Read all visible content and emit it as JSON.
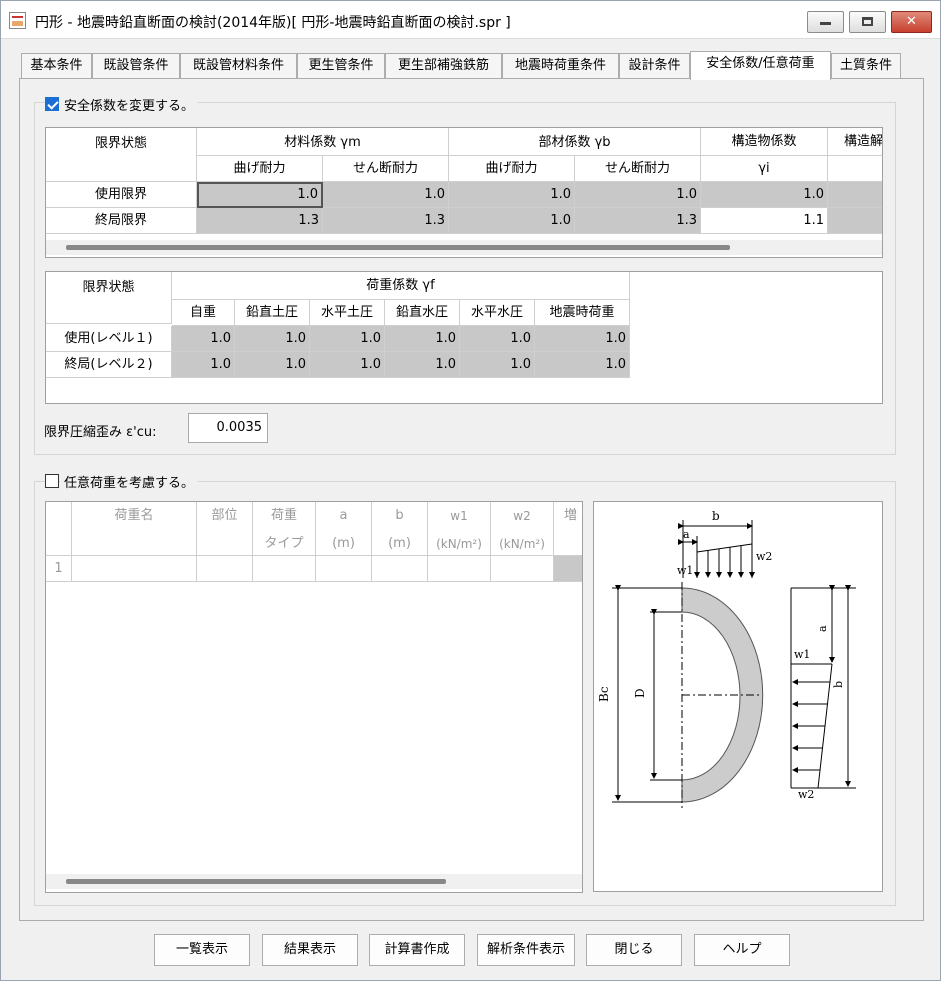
{
  "window": {
    "title": "円形 - 地震時鉛直断面の検討(2014年版)[ 円形-地震時鉛直断面の検討.spr ]"
  },
  "tabs": [
    "基本条件",
    "既設管条件",
    "既設管材料条件",
    "更生管条件",
    "更生部補強鉄筋",
    "地震時荷重条件",
    "設計条件",
    "安全係数/任意荷重",
    "土質条件"
  ],
  "safety": {
    "checkbox_label": "安全係数を変更する。",
    "checked": true,
    "table1": {
      "h_state": "限界状態",
      "h_material": "材料係数 γm",
      "h_member": "部材係数 γb",
      "h_structure": "構造物係数",
      "h_structure_sub": "γi",
      "h_cut": "構造解",
      "h_bend": "曲げ耐力",
      "h_shear": "せん断耐力",
      "rows": [
        {
          "label": "使用限界",
          "values": [
            "1.0",
            "1.0",
            "1.0",
            "1.0",
            "1.0"
          ]
        },
        {
          "label": "終局限界",
          "values": [
            "1.3",
            "1.3",
            "1.0",
            "1.3",
            "1.1"
          ]
        }
      ]
    },
    "table2": {
      "h_state": "限界状態",
      "h_load": "荷重係数 γf",
      "cols": [
        "自重",
        "鉛直土圧",
        "水平土圧",
        "鉛直水圧",
        "水平水圧",
        "地震時荷重"
      ],
      "rows": [
        {
          "label": "使用(レベル１)",
          "values": [
            "1.0",
            "1.0",
            "1.0",
            "1.0",
            "1.0",
            "1.0"
          ]
        },
        {
          "label": "終局(レベル２)",
          "values": [
            "1.0",
            "1.0",
            "1.0",
            "1.0",
            "1.0",
            "1.0"
          ]
        }
      ]
    },
    "strain_label": "限界圧縮歪み ε'cu:",
    "strain_value": "0.0035"
  },
  "arbitrary": {
    "checkbox_label": "任意荷重を考慮する。",
    "checked": false,
    "cols": [
      "荷重名",
      "部位",
      "荷重",
      "a",
      "b",
      "w1",
      "w2",
      "増"
    ],
    "cols2": [
      "",
      "",
      "タイプ",
      "(m)",
      "(m)",
      "(kN/m²)",
      "(kN/m²)",
      ""
    ],
    "row_num": "1"
  },
  "diagram": {
    "b": "b",
    "a": "a",
    "w1": "w1",
    "w2": "w2",
    "Bc": "Bc",
    "D": "D"
  },
  "buttons": [
    "一覧表示",
    "結果表示",
    "計算書作成",
    "解析条件表示",
    "閉じる",
    "ヘルプ"
  ]
}
